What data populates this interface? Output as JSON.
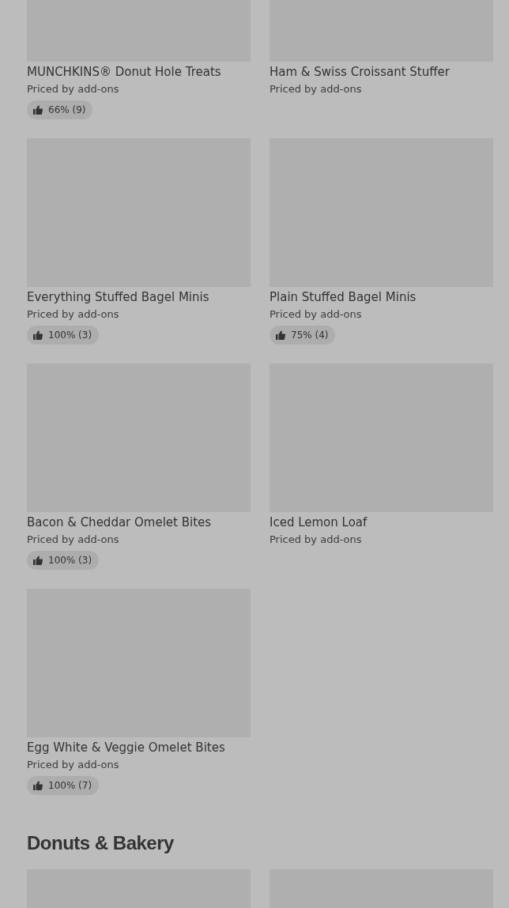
{
  "sections": [
    {
      "items": [
        {
          "kind": "item",
          "name": "MUNCHKINS® Donut Hole Treats",
          "price": "Priced by add-ons",
          "rating": "66% (9)"
        },
        {
          "kind": "item",
          "name": "Ham & Swiss Croissant Stuffer",
          "price": "Priced by add-ons"
        },
        {
          "kind": "item",
          "name": "Everything Stuffed Bagel Minis",
          "price": "Priced by add-ons",
          "rating": "100% (3)"
        },
        {
          "kind": "item",
          "name": "Plain Stuffed Bagel Minis",
          "price": "Priced by add-ons",
          "rating": "75% (4)"
        },
        {
          "kind": "item",
          "name": "Bacon & Cheddar Omelet Bites",
          "price": "Priced by add-ons",
          "rating": "100% (3)"
        },
        {
          "kind": "item",
          "name": "Iced Lemon Loaf",
          "price": "Priced by add-ons"
        },
        {
          "kind": "item",
          "name": "Egg White & Veggie Omelet Bites",
          "price": "Priced by add-ons",
          "rating": "100% (7)"
        }
      ]
    },
    {
      "title": "Donuts & Bakery",
      "items": [
        {
          "kind": "item"
        },
        {
          "kind": "item"
        }
      ]
    }
  ]
}
